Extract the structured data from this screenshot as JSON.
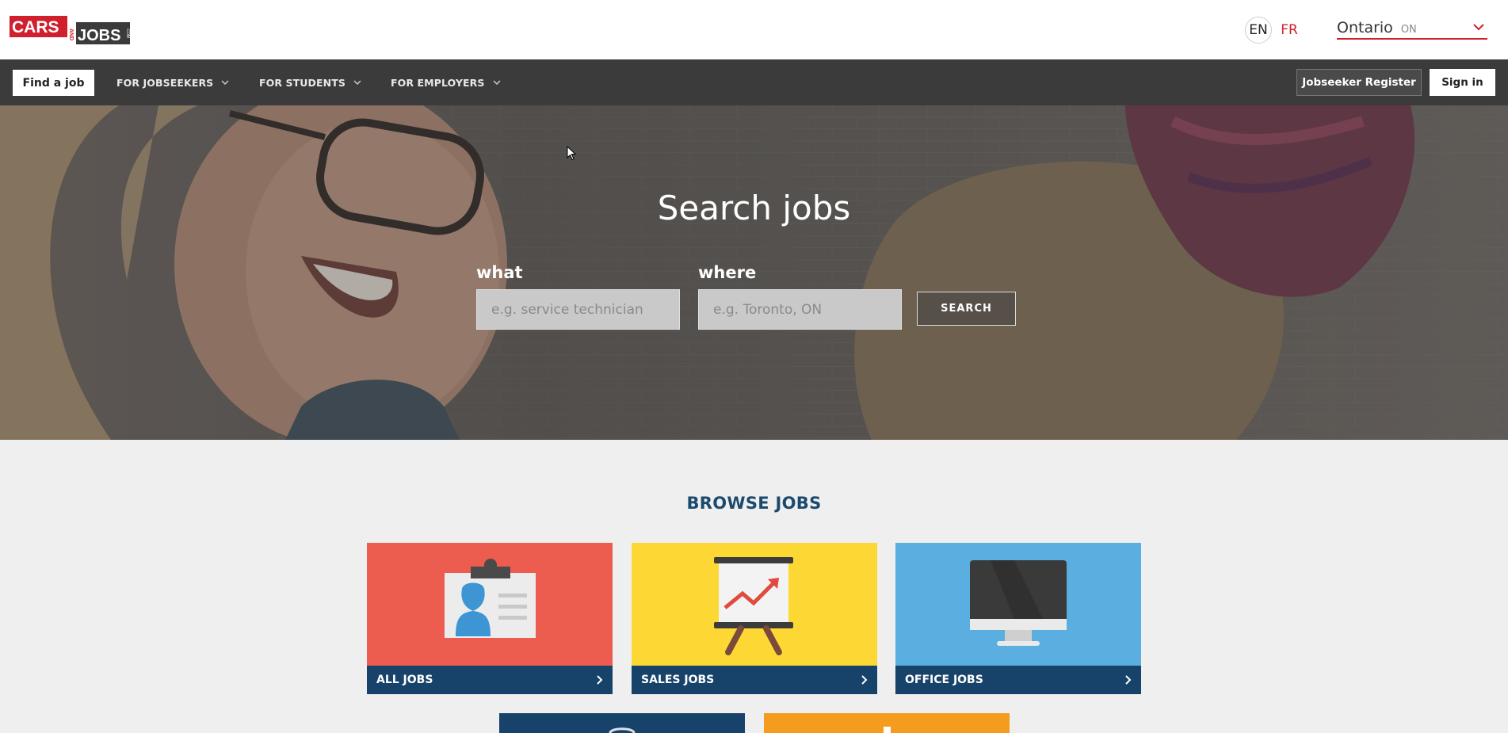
{
  "header": {
    "logo": {
      "top": "CARS",
      "and": "AND",
      "bottom": "JOBS",
      "dotcom": ".COM"
    },
    "lang_en": "EN",
    "lang_fr": "FR",
    "region_name": "Ontario",
    "region_code": "ON"
  },
  "nav": {
    "find_job": "Find a job",
    "items": [
      {
        "label": "FOR JOBSEEKERS"
      },
      {
        "label": "FOR STUDENTS"
      },
      {
        "label": "FOR EMPLOYERS"
      }
    ],
    "register": "Jobseeker Register",
    "signin": "Sign in"
  },
  "hero": {
    "title": "Search jobs",
    "what_label": "what",
    "what_placeholder": "e.g. service technician",
    "where_label": "where",
    "where_placeholder": "e.g. Toronto, ON",
    "search_button": "SEARCH"
  },
  "browse": {
    "title": "BROWSE JOBS",
    "tiles": [
      {
        "label": "ALL JOBS",
        "color": "#ec5c4f",
        "icon": "id-badge-icon"
      },
      {
        "label": "SALES JOBS",
        "color": "#fdd835",
        "icon": "presentation-chart-icon"
      },
      {
        "label": "OFFICE JOBS",
        "color": "#5aafe0",
        "icon": "monitor-icon"
      }
    ],
    "partial_tiles": [
      {
        "color": "#17426a"
      },
      {
        "color": "#f39c1f"
      }
    ]
  },
  "colors": {
    "brand_red": "#d0202e",
    "nav_bg": "#3b3b3b",
    "navy": "#17426a"
  }
}
